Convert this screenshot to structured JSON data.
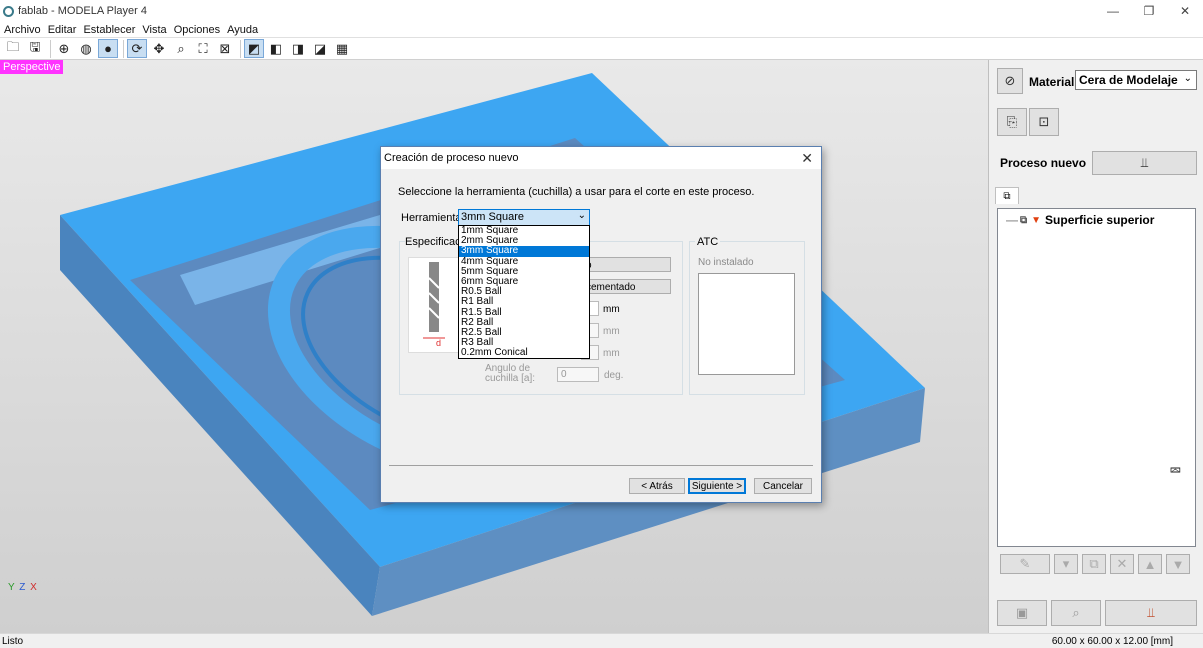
{
  "window": {
    "title": "fablab - MODELA Player 4",
    "controls": [
      "—",
      "❐",
      "✕"
    ]
  },
  "menu": [
    "Archivo",
    "Editar",
    "Establecer",
    "Vista",
    "Opciones",
    "Ayuda"
  ],
  "viewport": {
    "view_label": "Perspective",
    "axis": {
      "y": "Y",
      "z": "Z",
      "x": "X"
    }
  },
  "status": {
    "left": "Listo",
    "right": "60.00 x 60.00 x 12.00 [mm]"
  },
  "panel": {
    "material_label": "Material",
    "material_value": "Cera de Modelaje",
    "process_label": "Proceso nuevo",
    "tree_item": "Superficie superior"
  },
  "dialog": {
    "title": "Creación de proceso nuevo",
    "prompt": "Seleccione la herramienta (cuchilla) a usar para el corte en este proceso.",
    "tool_label": "Herramienta:",
    "tool_selected": "3mm Square",
    "spec_legend": "Especificacion",
    "field1_text": "o",
    "field2_text": "cementado",
    "unit_mm": "mm",
    "angle_label": "Angulo de cuchilla [a]:",
    "angle_value": "0",
    "unit_deg": "deg.",
    "tool_diagram_label": "d",
    "atc_legend": "ATC",
    "atc_status": "No instalado",
    "btn_back": "< Atrás",
    "btn_next": "Siguiente >",
    "btn_cancel": "Cancelar",
    "tool_options": [
      "1mm Square",
      "2mm Square",
      "3mm Square",
      "4mm Square",
      "5mm Square",
      "6mm Square",
      "R0.5 Ball",
      "R1 Ball",
      "R1.5 Ball",
      "R2 Ball",
      "R2.5 Ball",
      "R3 Ball",
      "0.2mm Conical"
    ],
    "selected_index": 2
  }
}
